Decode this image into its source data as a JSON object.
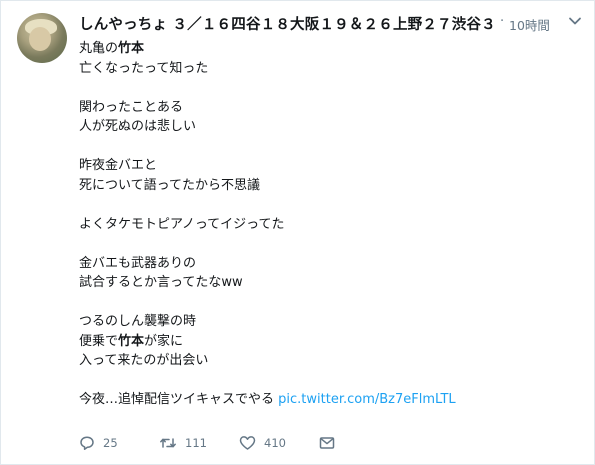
{
  "tweet": {
    "display_name": "しんやっちょ ３／１６四谷１８大阪１９＆２６上野２７渋谷３...",
    "separator": "·",
    "time": "10時間",
    "lines": {
      "l1_prefix": "丸亀の",
      "l1_bold": "竹本",
      "l2": "亡くなったって知った",
      "l3": "関わったことある",
      "l4": "人が死ぬのは悲しい",
      "l5": "昨夜金バエと",
      "l6": "死について語ってたから不思議",
      "l7": "よくタケモトピアノってイジってた",
      "l8": "金バエも武器ありの",
      "l9": "試合するとか言ってたなww",
      "l10": "つるのしん襲撃の時",
      "l11_prefix": "便乗で",
      "l11_bold": "竹本",
      "l11_suffix": "が家に",
      "l12": "入って来たのが出会い",
      "l13_text": "今夜…追悼配信ツイキャスでやる ",
      "l13_link": "pic.twitter.com/Bz7eFlmLTL"
    },
    "actions": {
      "replies": "25",
      "retweets": "111",
      "likes": "410"
    },
    "colors": {
      "link": "#1da1f2",
      "muted": "#657786"
    }
  }
}
